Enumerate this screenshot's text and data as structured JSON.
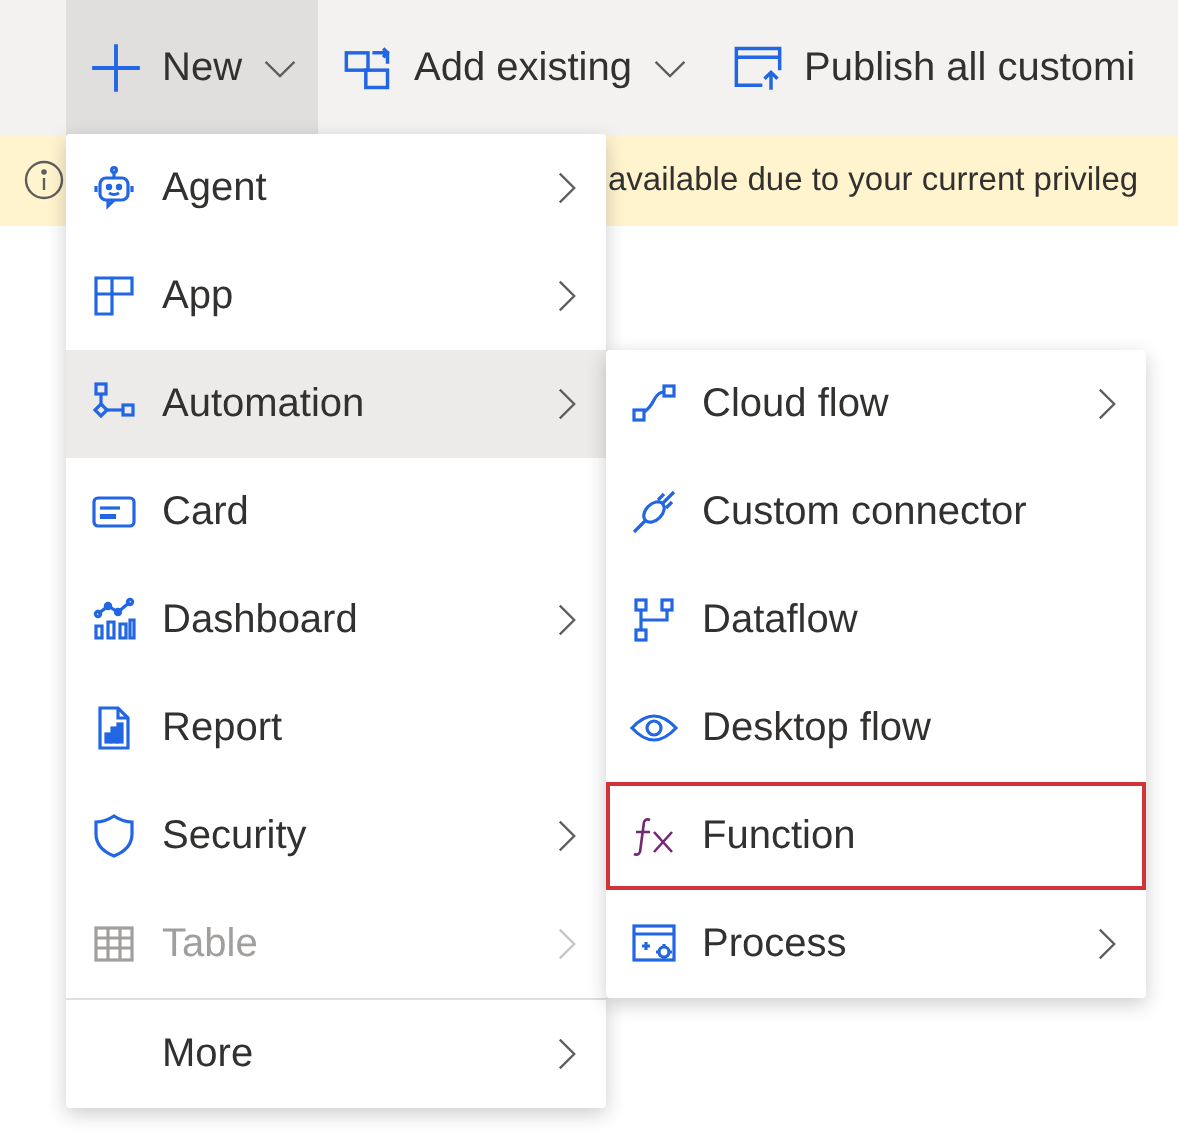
{
  "toolbar": [
    {
      "label": "New",
      "dropdown": true,
      "expanded": true
    },
    {
      "label": "Add existing",
      "dropdown": true,
      "expanded": false
    },
    {
      "label": "Publish all customi",
      "dropdown": false,
      "expanded": false
    }
  ],
  "banner": {
    "text": "available due to your current privileg"
  },
  "new_menu": {
    "items": [
      {
        "label": "Agent",
        "submenu": true,
        "selected": false,
        "disabled": false
      },
      {
        "label": "App",
        "submenu": true,
        "selected": false,
        "disabled": false
      },
      {
        "label": "Automation",
        "submenu": true,
        "selected": true,
        "disabled": false
      },
      {
        "label": "Card",
        "submenu": false,
        "selected": false,
        "disabled": false
      },
      {
        "label": "Dashboard",
        "submenu": true,
        "selected": false,
        "disabled": false
      },
      {
        "label": "Report",
        "submenu": false,
        "selected": false,
        "disabled": false
      },
      {
        "label": "Security",
        "submenu": true,
        "selected": false,
        "disabled": false
      },
      {
        "label": "Table",
        "submenu": true,
        "selected": false,
        "disabled": true
      }
    ],
    "more": {
      "label": "More",
      "submenu": true
    }
  },
  "automation_submenu": {
    "items": [
      {
        "label": "Cloud flow",
        "submenu": true,
        "highlighted": false
      },
      {
        "label": "Custom connector",
        "submenu": false,
        "highlighted": false
      },
      {
        "label": "Dataflow",
        "submenu": false,
        "highlighted": false
      },
      {
        "label": "Desktop flow",
        "submenu": false,
        "highlighted": false
      },
      {
        "label": "Function",
        "submenu": false,
        "highlighted": true
      },
      {
        "label": "Process",
        "submenu": true,
        "highlighted": false
      }
    ]
  }
}
